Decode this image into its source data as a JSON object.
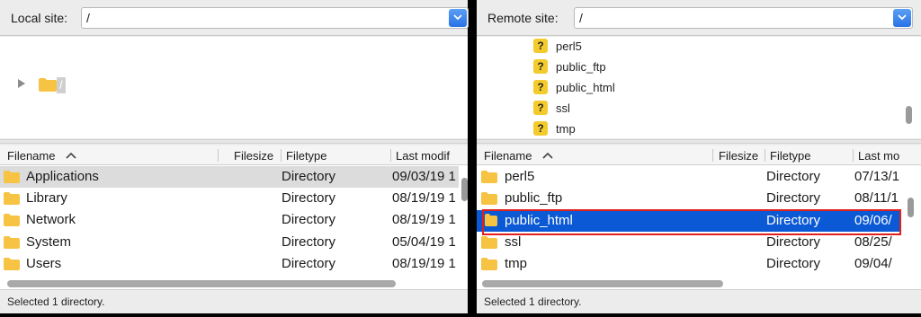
{
  "local": {
    "site_label": "Local site:",
    "site_path": "/",
    "tree": {
      "root_label": "/"
    },
    "columns": [
      "Filename",
      "Filesize",
      "Filetype",
      "Last modif"
    ],
    "files": [
      {
        "name": "Applications",
        "type": "Directory",
        "modified": "09/03/19 1"
      },
      {
        "name": "Library",
        "type": "Directory",
        "modified": "08/19/19 1"
      },
      {
        "name": "Network",
        "type": "Directory",
        "modified": "08/19/19 1"
      },
      {
        "name": "System",
        "type": "Directory",
        "modified": "05/04/19 1"
      },
      {
        "name": "Users",
        "type": "Directory",
        "modified": "08/19/19 1"
      }
    ],
    "status": "Selected 1 directory."
  },
  "remote": {
    "site_label": "Remote site:",
    "site_path": "/",
    "tree": [
      "perl5",
      "public_ftp",
      "public_html",
      "ssl",
      "tmp"
    ],
    "columns": [
      "Filename",
      "Filesize",
      "Filetype",
      "Last mo"
    ],
    "files": [
      {
        "name": "perl5",
        "type": "Directory",
        "modified": "07/13/1"
      },
      {
        "name": "public_ftp",
        "type": "Directory",
        "modified": "08/11/1"
      },
      {
        "name": "public_html",
        "type": "Directory",
        "modified": "09/06/"
      },
      {
        "name": "ssl",
        "type": "Directory",
        "modified": "08/25/"
      },
      {
        "name": "tmp",
        "type": "Directory",
        "modified": "09/04/"
      }
    ],
    "status": "Selected 1 directory."
  },
  "colors": {
    "selection_blue": "#0b59d4",
    "highlight_red": "#e0201c",
    "folder_yellow": "#f6c343",
    "unknown_badge": "#f4cb2c"
  },
  "icons": {
    "folder": "folder-icon",
    "unknown": "question-mark-icon",
    "expand": "disclosure-triangle-icon",
    "sort": "sort-ascending-icon",
    "dropdown": "chevron-down-icon"
  }
}
